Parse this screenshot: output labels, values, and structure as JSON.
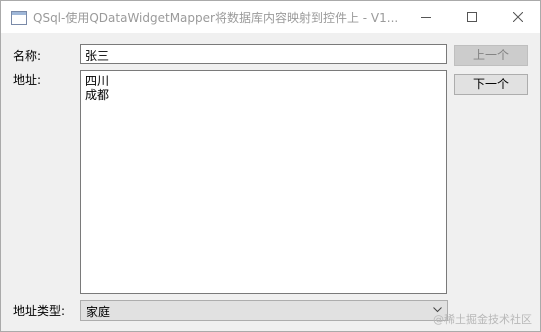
{
  "window": {
    "title": "QSql-使用QDataWidgetMapper将数据库内容映射到控件上 - V1..."
  },
  "icons": {
    "app": "app-window-icon",
    "minimize": "minimize-icon",
    "maximize": "maximize-icon",
    "close": "close-icon",
    "dropdown": "chevron-down-icon"
  },
  "form": {
    "name_label": "名称:",
    "name_value": "张三",
    "address_label": "地址:",
    "address_lines": [
      "四川",
      "成都"
    ],
    "address_type_label": "地址类型:",
    "address_type_value": "家庭"
  },
  "buttons": {
    "prev": "上一个",
    "next": "下一个"
  },
  "watermark": "@稀土掘金技术社区",
  "colors": {
    "window_bg": "#f0f0f0",
    "titlebar_bg": "#ffffff",
    "button_bg": "#e1e1e1",
    "disabled_button_bg": "#cccccc",
    "input_border": "#7a7a7a"
  }
}
